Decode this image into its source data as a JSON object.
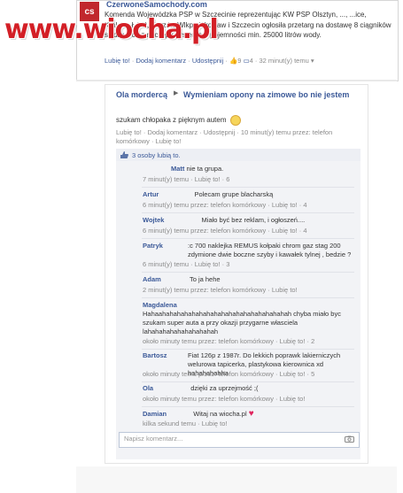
{
  "watermark": {
    "text": "www.wiocha.pl"
  },
  "top_post": {
    "logo_text": "cs",
    "page_name": "CzerwoneSamochody.com",
    "body": "Komenda Wojewódzka PSP w Szczecinie reprezentując KW PSP Olsztyn, ..., ...ice, Kraków, Łódź, Gorzów Wlkp., Wrocław i Szczecin ogłosiła przetarg na dostawę 8 ciągników siodłowych z naczepą cysterną o pojemności min. 25000 litrów wody.",
    "meta": {
      "like": "Lubię to!",
      "comment": "Dodaj komentarz",
      "share": "Udostępnij",
      "likes_count": "9",
      "comments_count": "4",
      "time": "32 minut(y) temu"
    }
  },
  "post": {
    "author": "Ola mordercą",
    "target": "Wymieniam opony na zimowe bo nie jestem",
    "text": "szukam chłopaka z pięknym autem",
    "meta": "Lubię to! · Dodaj komentarz · Udostępnij · 10 minut(y) temu przez: telefon komórkowy · Lubię to!",
    "likes_text": "3 osoby lubią to."
  },
  "comments": [
    {
      "author": "Matt",
      "text": "nie ta grupa.",
      "meta": "7 minut(y) temu · Lubię to! · 6"
    },
    {
      "author": "Artur",
      "text": "Polecam grupe blacharską",
      "meta": "6 minut(y) temu przez: telefon komórkowy · Lubię to! · 4"
    },
    {
      "author": "Wojtek",
      "text": "Miało być bez reklam, i ogłoszeń....",
      "meta": "6 minut(y) temu przez: telefon komórkowy · Lubię to! · 4"
    },
    {
      "author": "Patryk",
      "text": ":c 700 naklejka REMUS kołpaki chrom gaz stag 200 zdymione dwie boczne szyby i kawałek tylnej , bedzie ?",
      "meta": "6 minut(y) temu · Lubię to! · 3"
    },
    {
      "author": "Adam",
      "text": "To ja hehe",
      "meta": "2 minut(y) temu przez: telefon komórkowy · Lubię to!"
    },
    {
      "author": "Magdalena",
      "text": "Hahaahahahahahahahahahahahahahahahahahah chyba miało byc szukam super auta a przy okazji przygarne własciela lahahahahahahahahahah",
      "meta": "około minuty temu przez: telefon komórkowy · Lubię to! · 2"
    },
    {
      "author": "Bartosz",
      "text": "Fiat 126p z 1987r. Do lekkich poprawk lakierniczych welurowa tapicerka, plastykowa kierownica xd hahahahahha",
      "meta": "około minuty temu przez: telefon komórkowy · Lubię to! · 5"
    },
    {
      "author": "Ola",
      "text": "dzięki za uprzejmość ;(",
      "meta": "około minuty temu przez: telefon komórkowy · Lubię to!"
    },
    {
      "author": "Damian",
      "text": "Witaj na wiocha.pl",
      "meta": "kilka sekund temu · Lubię to!"
    }
  ],
  "composer": {
    "placeholder": "Napisz komentarz..."
  },
  "colors": {
    "link": "#3b5998",
    "watermark": "#d31f26",
    "heart": "#e0245e",
    "comment_bg": "#f2f3f6"
  }
}
